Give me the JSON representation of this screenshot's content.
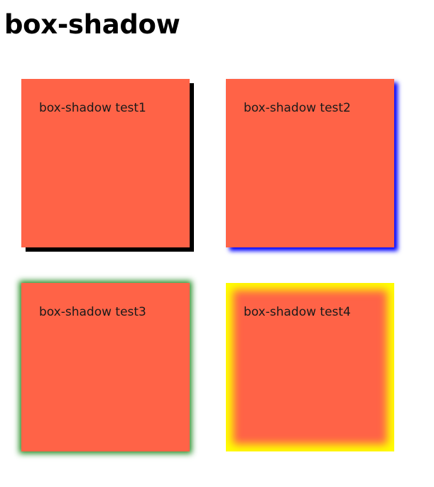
{
  "page": {
    "title": "box-shadow",
    "box_color": "#FF6347"
  },
  "boxes": [
    {
      "label": "box-shadow test1",
      "shadow_color": "#000000",
      "shadow_style": "offset"
    },
    {
      "label": "box-shadow test2",
      "shadow_color": "#0000FF",
      "shadow_style": "offset-blur"
    },
    {
      "label": "box-shadow test3",
      "shadow_color": "#228B22",
      "shadow_style": "blur-all-sides"
    },
    {
      "label": "box-shadow test4",
      "shadow_color": "#FFFF00",
      "shadow_style": "inset"
    }
  ]
}
